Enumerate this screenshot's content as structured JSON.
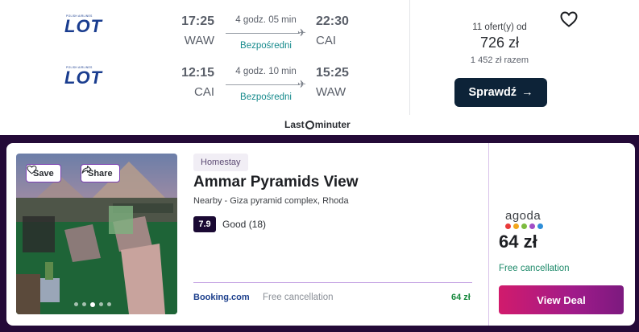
{
  "flight": {
    "airline_logo_text": "LOT",
    "airline_logo_tagline": "POLISH AIRLINES",
    "legs": [
      {
        "dep_time": "17:25",
        "dep_city": "WAW",
        "duration": "4 godz. 05 min",
        "stops": "Bezpośredni",
        "arr_time": "22:30",
        "arr_city": "CAI"
      },
      {
        "dep_time": "12:15",
        "dep_city": "CAI",
        "duration": "4 godz. 10 min",
        "stops": "Bezpośredni",
        "arr_time": "15:25",
        "arr_city": "WAW"
      }
    ],
    "offers": "11 ofert(y) od",
    "price": "726 zł",
    "price_total": "1 452 zł razem",
    "check_button": "Sprawdź",
    "provider_logo_left": "Last",
    "provider_logo_right": "minuter"
  },
  "hotel": {
    "save_label": "Save",
    "share_label": "Share",
    "photo_dots": 5,
    "photo_active_dot": 3,
    "type": "Homestay",
    "name": "Ammar Pyramids View",
    "location": "Nearby - Giza pyramid complex, Rhoda",
    "score": "7.9",
    "rating_text": "Good (18)",
    "provider": {
      "name": "Booking.com",
      "cancellation": "Free cancellation",
      "price": "64 zł"
    },
    "deal": {
      "provider": "agoda",
      "price": "64 zł",
      "cancellation": "Free cancellation",
      "button": "View Deal"
    }
  },
  "colors": {
    "navy_button": "#0d2338",
    "teal_text": "#168a8c",
    "dark_band": "#240a38",
    "deal_gradient_start": "#d11b6c",
    "deal_gradient_end": "#7c1a7f",
    "green_text": "#16883c"
  },
  "icons": [
    "heart-icon",
    "plane-icon",
    "arrow-right-icon",
    "share-icon",
    "clock-icon"
  ]
}
